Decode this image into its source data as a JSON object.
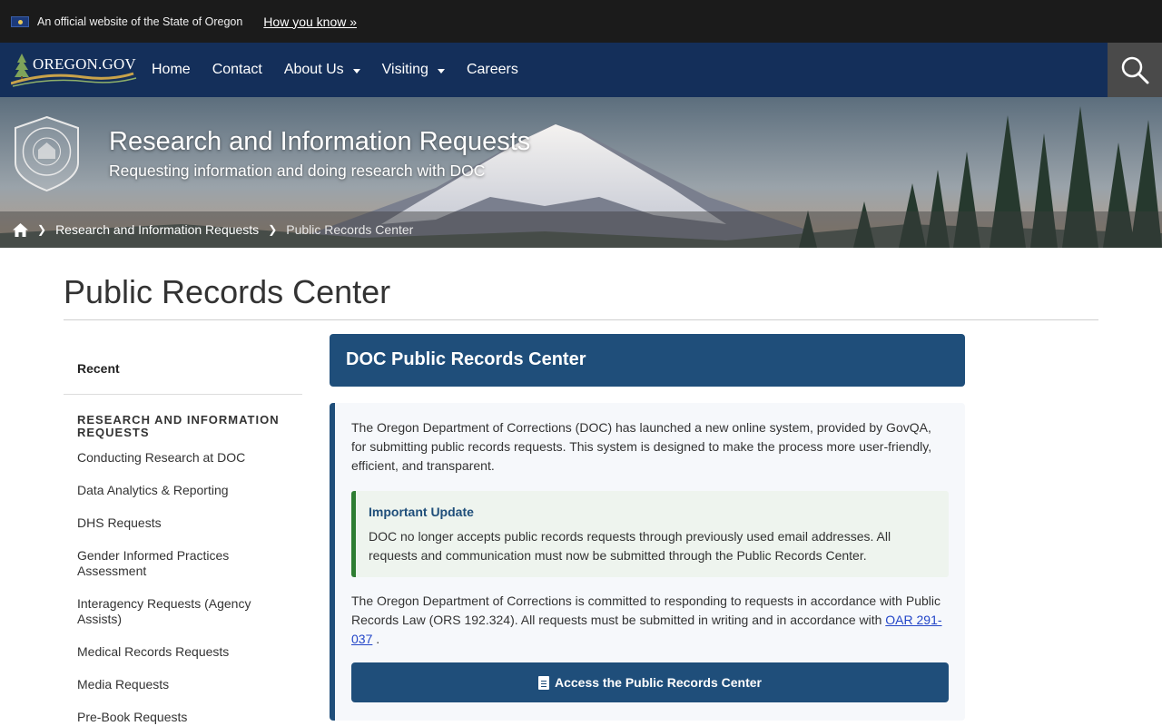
{
  "banner": {
    "official_text": "An official website of the State of Oregon",
    "how_you_know": "How you know »"
  },
  "nav": {
    "brand": "OREGON.GOV",
    "items": [
      {
        "label": "Home",
        "dropdown": false
      },
      {
        "label": "Contact",
        "dropdown": false
      },
      {
        "label": "About Us",
        "dropdown": true
      },
      {
        "label": "Visiting",
        "dropdown": true
      },
      {
        "label": "Careers",
        "dropdown": false
      }
    ]
  },
  "hero": {
    "title": "Research and Information Requests",
    "subtitle": "Requesting information and doing research with DOC",
    "seal_text": "OREGON DEPARTMENT OF CORRECTIONS"
  },
  "breadcrumb": {
    "items": [
      "Research and Information Requests",
      "Public Records Center"
    ]
  },
  "page": {
    "title": "Public Records Center"
  },
  "sidebar": {
    "recent": "Recent",
    "heading": "RESEARCH AND INFORMATION REQUESTS",
    "items": [
      "Conducting Research at DOC",
      "Data Analytics & Reporting",
      "DHS Requests",
      "Gender Informed Practices Assessment",
      "Interagency Requests (Agency Assists)",
      "Medical Records Requests",
      "Media Requests",
      "Pre-Book Requests"
    ]
  },
  "main": {
    "header": "DOC Public Records Center",
    "intro": "The Oregon Department of Corrections (DOC) has launched a new online system, provided by GovQA, for submitting public records requests. This system is designed to make the process more user-friendly, efficient, and transparent.",
    "alert_title": "Important Update",
    "alert_text": "DOC no longer accepts public records requests through previously used email addresses. All requests and communication must now be submitted through the Public Records Center.",
    "law_text": "The Oregon Department of Corrections is committed to responding to requests in accordance with Public Records Law (ORS 192.324). All requests must be submitted in writing and in accordance with",
    "law_link": "OAR 291-037",
    "law_end": ".",
    "cta_label": "Access the Public Records Center"
  },
  "colors": {
    "banner_bg": "#1b1b1b",
    "nav_bg": "#142f5a",
    "accent": "#1f4e7a",
    "alert_border": "#2e7d32"
  }
}
